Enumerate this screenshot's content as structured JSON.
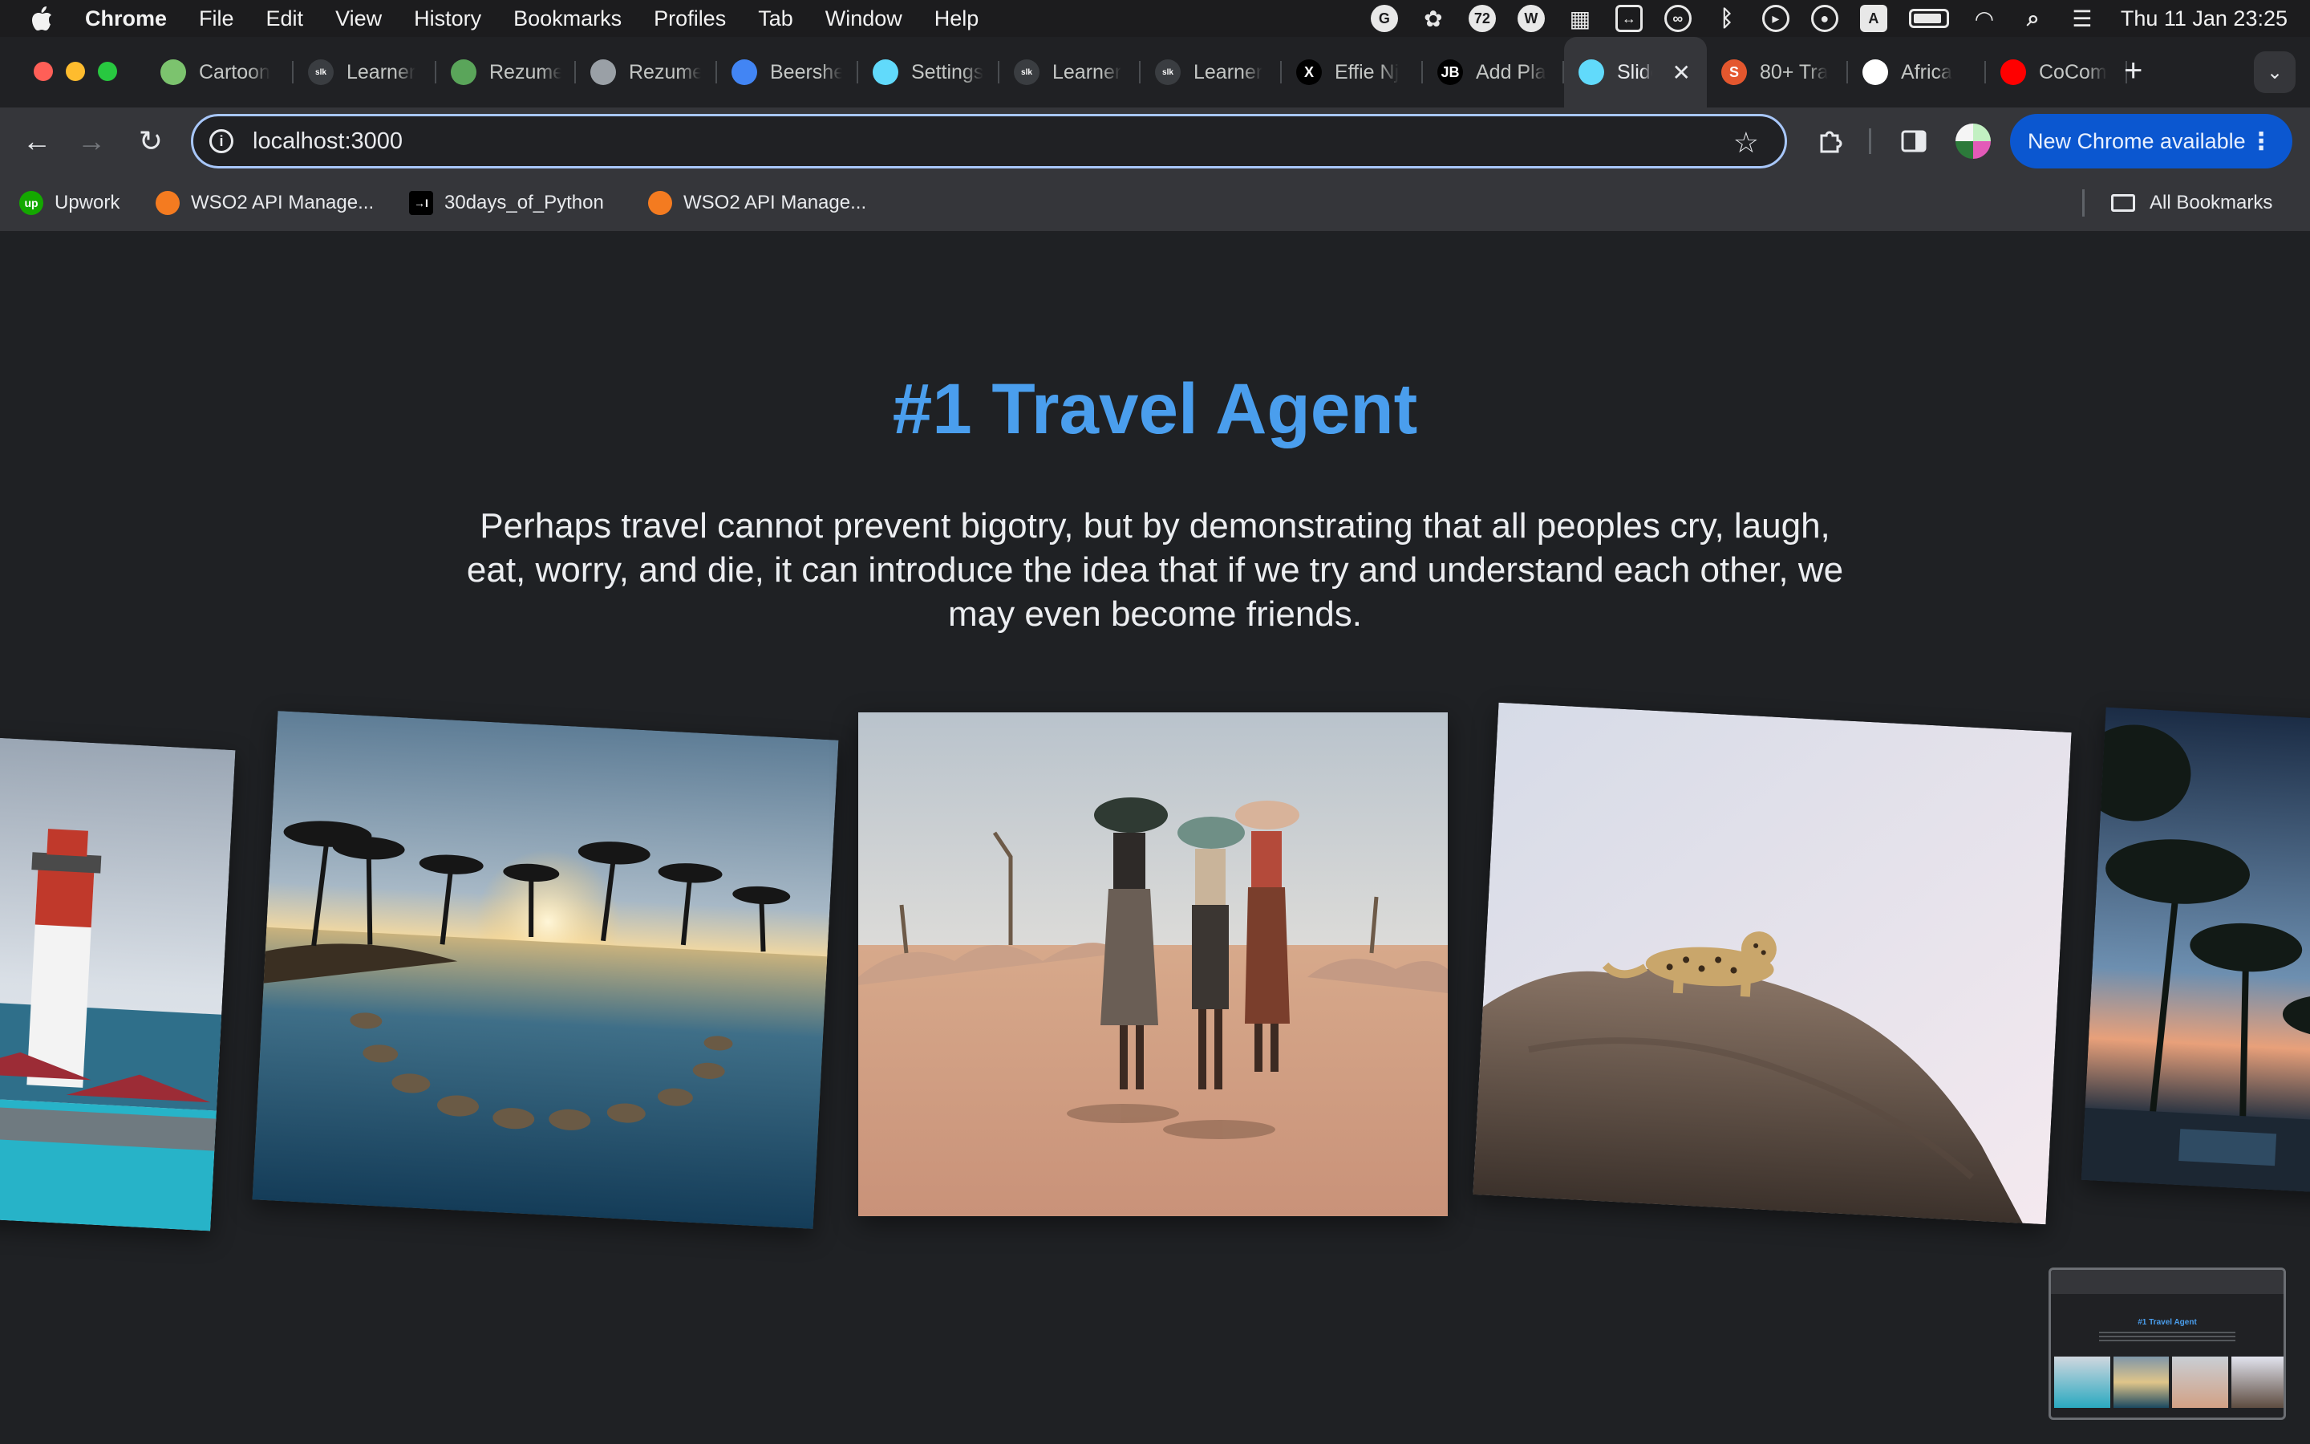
{
  "menubar": {
    "app_name": "Chrome",
    "menus": [
      "File",
      "Edit",
      "View",
      "History",
      "Bookmarks",
      "Profiles",
      "Tab",
      "Window",
      "Help"
    ],
    "status_icons": [
      "grammarly-icon",
      "raycast-icon",
      "messages-badge-icon",
      "wordpress-icon",
      "stage-manager-icon",
      "screen-capture-icon",
      "creative-cloud-icon",
      "bluetooth-icon",
      "play-icon",
      "user-icon",
      "input-source-icon",
      "battery-icon",
      "wifi-icon",
      "spotlight-icon",
      "control-center-icon"
    ],
    "messages_badge": "72",
    "input_source": "A",
    "clock": "Thu 11 Jan  23:25"
  },
  "tabs": [
    {
      "title": "Cartoon",
      "color": "#7cc36e"
    },
    {
      "title": "Learner",
      "color": "#3a3d41"
    },
    {
      "title": "Rezume",
      "color": "#5aa55a"
    },
    {
      "title": "Rezume",
      "color": "#9aa0a6"
    },
    {
      "title": "Beersheba",
      "color": "#4285f4"
    },
    {
      "title": "Settings",
      "color": "#61dafb"
    },
    {
      "title": "Learner",
      "color": "#3a3d41"
    },
    {
      "title": "Learner",
      "color": "#3a3d41"
    },
    {
      "title": "Effie Nj",
      "color": "#000000"
    },
    {
      "title": "Add Pla",
      "color": "#000000"
    },
    {
      "title": "Slider",
      "color": "#61dafb"
    },
    {
      "title": "80+ Tra",
      "color": "#e4572e"
    },
    {
      "title": "Africa",
      "color": "#ffffff"
    },
    {
      "title": "CoCom",
      "color": "#ff0000"
    }
  ],
  "tab_marks": [
    "",
    "slk",
    "",
    "",
    "",
    "",
    "slk",
    "slk",
    "X",
    "JB",
    "",
    "S",
    "",
    ""
  ],
  "active_tab_index": 10,
  "active_tab_close": "✕",
  "new_tab_label": "+",
  "toolbar": {
    "url": "localhost:3000",
    "update_label": "New Chrome available"
  },
  "bookmarks": [
    {
      "label": "Upwork",
      "color": "#14a800",
      "mark": "up"
    },
    {
      "label": "WSO2 API Manage...",
      "color": "#f47b20",
      "mark": ""
    },
    {
      "label": "30days_of_Python",
      "color": "#000000",
      "mark": "→I"
    },
    {
      "label": "WSO2 API Manage...",
      "color": "#f47b20",
      "mark": ""
    }
  ],
  "all_bookmarks_label": "All Bookmarks",
  "hero": {
    "title": "#1 Travel Agent",
    "subtitle": "Perhaps travel cannot prevent bigotry, but by demonstrating that all peoples cry, laugh, eat, worry, and die, it can introduce the idea that if we try and understand each other, we may even become friends."
  },
  "colors": {
    "accent": "#4a9eed",
    "page_bg": "#1f2124",
    "chrome_update": "#0b57d0"
  },
  "slides": [
    {
      "image": "lighthouse-beach-resort"
    },
    {
      "image": "palm-sunset-pool"
    },
    {
      "image": "women-carrying-baskets"
    },
    {
      "image": "leopard-on-rock"
    },
    {
      "image": "tropical-palms-dusk"
    }
  ],
  "preview": {
    "title": "#1 Travel Agent"
  }
}
